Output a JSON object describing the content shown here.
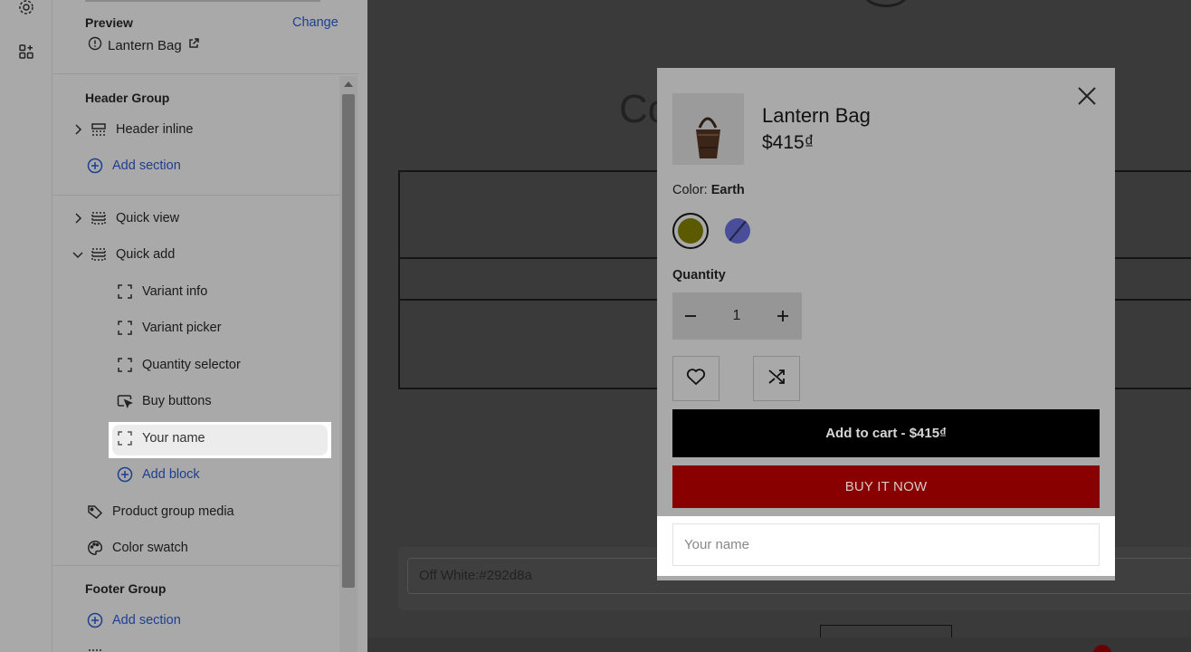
{
  "preview": {
    "label": "Preview",
    "change": "Change",
    "page_name": "Lantern Bag"
  },
  "tree": {
    "header_group": "Header Group",
    "header_inline": "Header inline",
    "add_section": "Add section",
    "quick_view": "Quick view",
    "quick_add": "Quick add",
    "blocks": [
      "Variant info",
      "Variant picker",
      "Quantity selector",
      "Buy buttons",
      "Your name"
    ],
    "add_block": "Add block",
    "product_group_media": "Product group media",
    "color_swatch": "Color swatch",
    "footer_group": "Footer Group",
    "footer_add_section": "Add section"
  },
  "canvas": {
    "bg_title": "Co                                        lia",
    "swatch_value": "Off White:#292d8a"
  },
  "modal": {
    "product_name": "Lantern Bag",
    "price": "$415₫",
    "color_prefix": "Color: ",
    "color_value": "Earth",
    "quantity_label": "Quantity",
    "quantity_value": "1",
    "add_to_cart": "Add to cart - $415₫",
    "buy_now": "BUY IT NOW",
    "name_placeholder": "Your name"
  },
  "colors": {
    "link": "#1d3f8f",
    "buy_now": "#880000",
    "earth_swatch": "#5c5a00",
    "alt_swatch": "#4a4e98"
  }
}
